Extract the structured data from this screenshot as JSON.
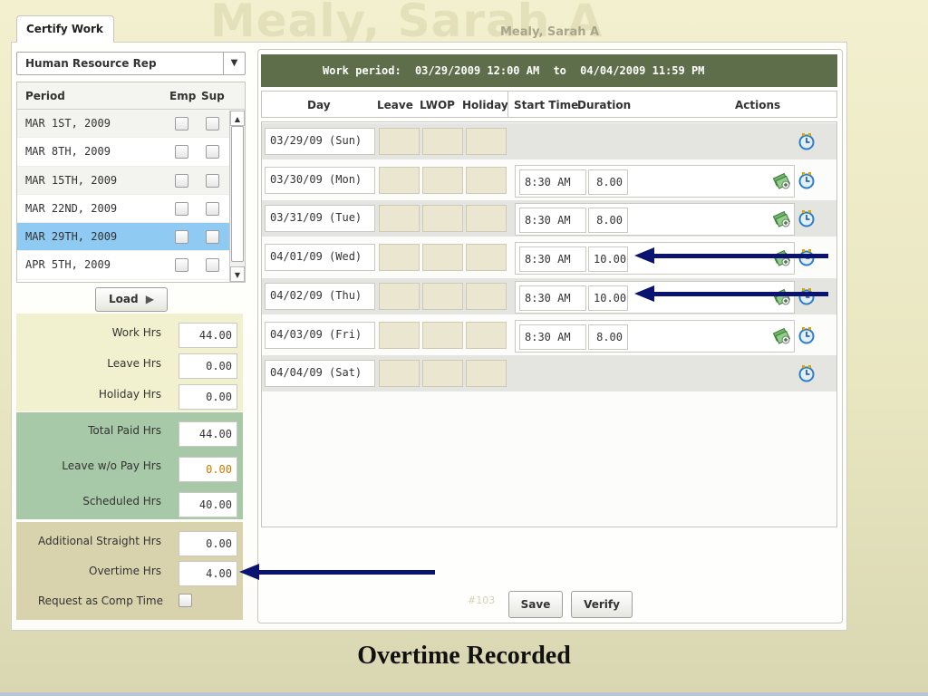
{
  "header": {
    "watermark_name": "Mealy, Sarah A",
    "user_name": "Mealy, Sarah A"
  },
  "tab": {
    "label": "Certify Work"
  },
  "role_select": {
    "value": "Human Resource Rep",
    "arrow": "▼"
  },
  "period_table": {
    "headers": {
      "period": "Period",
      "emp": "Emp",
      "sup": "Sup"
    },
    "rows": [
      {
        "period": "MAR 1ST, 2009"
      },
      {
        "period": "MAR 8TH, 2009"
      },
      {
        "period": "MAR 15TH, 2009"
      },
      {
        "period": "MAR 22ND, 2009"
      },
      {
        "period": "MAR 29TH, 2009",
        "selected": true
      },
      {
        "period": "APR 5TH, 2009"
      }
    ],
    "scroll_up": "▲",
    "scroll_down": "▼"
  },
  "load_button": {
    "label": "Load",
    "icon": "▶"
  },
  "summary": {
    "work_hrs": {
      "label": "Work Hrs",
      "value": "44.00"
    },
    "leave_hrs": {
      "label": "Leave Hrs",
      "value": "0.00"
    },
    "holiday_hrs": {
      "label": "Holiday Hrs",
      "value": "0.00"
    },
    "total_paid_hrs": {
      "label": "Total Paid Hrs",
      "value": "44.00"
    },
    "leave_wo_pay_hrs": {
      "label": "Leave w/o Pay Hrs",
      "value": "0.00"
    },
    "scheduled_hrs": {
      "label": "Scheduled Hrs",
      "value": "40.00"
    },
    "additional_straight_hrs": {
      "label": "Additional Straight Hrs",
      "value": "0.00"
    },
    "overtime_hrs": {
      "label": "Overtime Hrs",
      "value": "4.00"
    },
    "request_comp_time": {
      "label": "Request as Comp Time"
    }
  },
  "work_period": {
    "label": "Work period:",
    "start": "03/29/2009 12:00 AM",
    "to": "to",
    "end": "04/04/2009 11:59 PM"
  },
  "grid": {
    "headers": {
      "day": "Day",
      "leave": "Leave",
      "lwop": "LWOP",
      "holiday": "Holiday",
      "start_time": "Start Time",
      "duration": "Duration",
      "actions": "Actions"
    },
    "rows": [
      {
        "day": "03/29/09 (Sun)"
      },
      {
        "day": "03/30/09 (Mon)",
        "start": "8:30 AM",
        "duration": "8.00"
      },
      {
        "day": "03/31/09 (Tue)",
        "start": "8:30 AM",
        "duration": "8.00"
      },
      {
        "day": "04/01/09 (Wed)",
        "start": "8:30 AM",
        "duration": "10.00"
      },
      {
        "day": "04/02/09 (Thu)",
        "start": "8:30 AM",
        "duration": "10.00"
      },
      {
        "day": "04/03/09 (Fri)",
        "start": "8:30 AM",
        "duration": "8.00"
      },
      {
        "day": "04/04/09 (Sat)"
      }
    ]
  },
  "page_id": "#103",
  "buttons": {
    "save": "Save",
    "verify": "Verify"
  },
  "caption": "Overtime Recorded",
  "colors": {
    "work_period_bar": "#5e6e4a",
    "selected_row": "#8fcaf3",
    "arrow": "#0a1470",
    "summary_green": "#a8c9a8"
  },
  "icons": {
    "money": "money-icon",
    "clock": "clock-icon",
    "arrow": "left-arrow-icon"
  }
}
